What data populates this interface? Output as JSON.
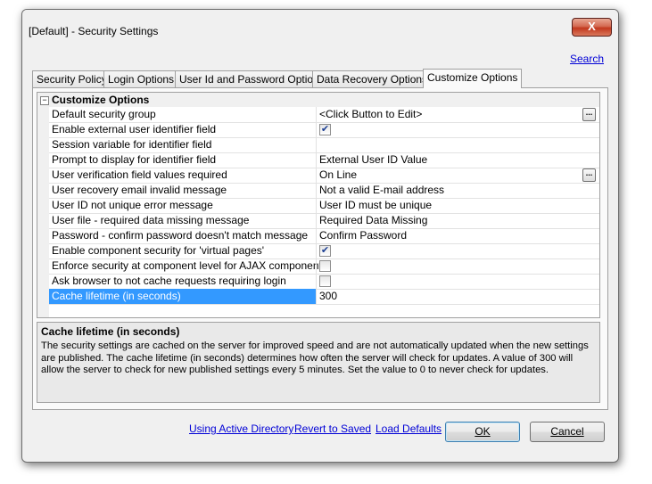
{
  "window": {
    "title": "[Default] - Security Settings",
    "close_label": "X"
  },
  "header": {
    "search_link": "Search"
  },
  "tabs": [
    {
      "label": "Security Policy",
      "active": false
    },
    {
      "label": "Login Options",
      "active": false
    },
    {
      "label": "User Id and Password Options",
      "active": false
    },
    {
      "label": "Data Recovery Options",
      "active": false
    },
    {
      "label": "Customize Options",
      "active": true
    }
  ],
  "grid": {
    "category": "Customize Options",
    "expander": "−",
    "rows": [
      {
        "name": "Default security group",
        "value": "<Click Button to Edit>",
        "type": "button",
        "button_label": "..."
      },
      {
        "name": "Enable external user identifier field",
        "value": "",
        "type": "checkbox",
        "checked": true
      },
      {
        "name": "Session variable for identifier field",
        "value": "",
        "type": "text"
      },
      {
        "name": "Prompt to display for identifier field",
        "value": "External User ID Value",
        "type": "text"
      },
      {
        "name": "User verification field values required",
        "value": "On Line",
        "type": "button",
        "button_label": "..."
      },
      {
        "name": "User recovery email invalid message",
        "value": "Not a valid E-mail address",
        "type": "text"
      },
      {
        "name": "User ID not unique error message",
        "value": "User ID must be unique",
        "type": "text"
      },
      {
        "name": "User file - required data missing message",
        "value": "Required Data Missing",
        "type": "text"
      },
      {
        "name": "Password - confirm password doesn't match message",
        "value": "Confirm Password",
        "type": "text"
      },
      {
        "name": "Enable component security for 'virtual pages'",
        "value": "",
        "type": "checkbox",
        "checked": true
      },
      {
        "name": "Enforce security at component level for AJAX components",
        "value": "",
        "type": "checkbox",
        "checked": false
      },
      {
        "name": "Ask browser to not cache requests requiring login",
        "value": "",
        "type": "checkbox",
        "checked": false
      },
      {
        "name": "Cache lifetime (in seconds)",
        "value": "300",
        "type": "text",
        "selected": true
      }
    ],
    "check_glyph": "✔"
  },
  "description": {
    "title": "Cache lifetime (in seconds)",
    "text": "The security settings are cached on the server for improved speed and are not automatically updated when the new settings are published.  The cache lifetime (in seconds) determines how often the server will check for updates.  A value of 300 will allow the server to check for new published settings every 5 minutes.  Set the value to 0 to never check for updates."
  },
  "footer": {
    "links": [
      "Using Active Directory",
      "Revert to Saved",
      "Load Defaults"
    ],
    "ok_label": "OK",
    "cancel_label": "Cancel"
  },
  "colors": {
    "selection": "#3399ff",
    "link": "#0000d6",
    "close_button": "#c2381e"
  }
}
